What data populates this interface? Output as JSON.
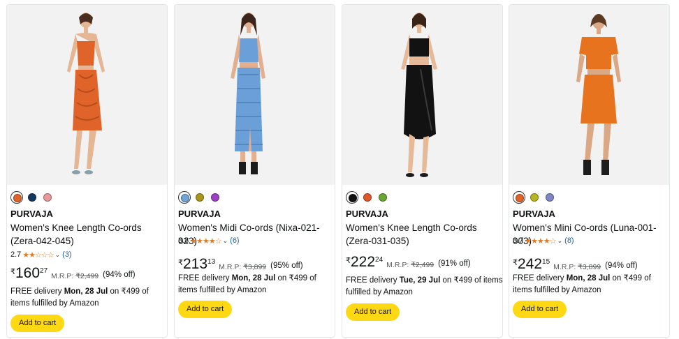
{
  "products": [
    {
      "swatches": [
        "#e0642a",
        "#15375e",
        "#e89a9a"
      ],
      "brand": "PURVAJA",
      "title": "Women's Knee Length Co-ords (Zera-042-045)",
      "rating": "2.7",
      "stars": "★★☆☆☆",
      "reviews": "(3)",
      "currency": "₹",
      "price_whole": "160",
      "price_fraction": "27",
      "mrp_label": "M.R.P:",
      "mrp": "₹2,499",
      "discount": "(94% off)",
      "delivery_prefix": "FREE delivery",
      "delivery_date": "Mon, 28 Jul",
      "delivery_suffix": "on ₹499 of items fulfilled by Amazon",
      "cart_label": "Add to cart",
      "outfit_color": "#e0642a",
      "skin": "#e4b694"
    },
    {
      "swatches": [
        "#6fa4d6",
        "#a9951e",
        "#9c3fc2"
      ],
      "brand": "PURVAJA",
      "title": "Women's Midi Co-ords (Nixa-021-023)",
      "rating": "3.8",
      "stars": "★★★★☆",
      "reviews": "(6)",
      "currency": "₹",
      "price_whole": "213",
      "price_fraction": "13",
      "mrp_label": "M.R.P:",
      "mrp": "₹3,899",
      "discount": "(95% off)",
      "delivery_prefix": "FREE delivery",
      "delivery_date": "Mon, 28 Jul",
      "delivery_suffix": "on ₹499 of items fulfilled by Amazon",
      "cart_label": "Add to cart",
      "outfit_color": "#6a9fd8",
      "skin": "#e2b091"
    },
    {
      "swatches": [
        "#111111",
        "#e0552a",
        "#6aa532"
      ],
      "brand": "PURVAJA",
      "title": "Women's Knee Length Co-ords (Zera-031-035)",
      "rating": "",
      "stars": "",
      "reviews": "",
      "currency": "₹",
      "price_whole": "222",
      "price_fraction": "24",
      "mrp_label": "M.R.P:",
      "mrp": "₹2,499",
      "discount": "(91% off)",
      "delivery_prefix": "FREE delivery",
      "delivery_date": "Tue, 29 Jul",
      "delivery_suffix": "on ₹499 of items fulfilled by Amazon",
      "cart_label": "Add to cart",
      "outfit_color": "#121212",
      "skin": "#e6b998"
    },
    {
      "swatches": [
        "#e0642a",
        "#b8b523",
        "#7f86c4"
      ],
      "brand": "PURVAJA",
      "title": "Women's Mini Co-ords (Luna-001-003)",
      "rating": "3.7",
      "stars": "★★★★☆",
      "reviews": "(8)",
      "currency": "₹",
      "price_whole": "242",
      "price_fraction": "15",
      "mrp_label": "M.R.P:",
      "mrp": "₹3,899",
      "discount": "(94% off)",
      "delivery_prefix": "FREE delivery",
      "delivery_date": "Mon, 28 Jul",
      "delivery_suffix": "on ₹499 of items fulfilled by Amazon",
      "cart_label": "Add to cart",
      "outfit_color": "#e8731f",
      "skin": "#dba886"
    }
  ]
}
